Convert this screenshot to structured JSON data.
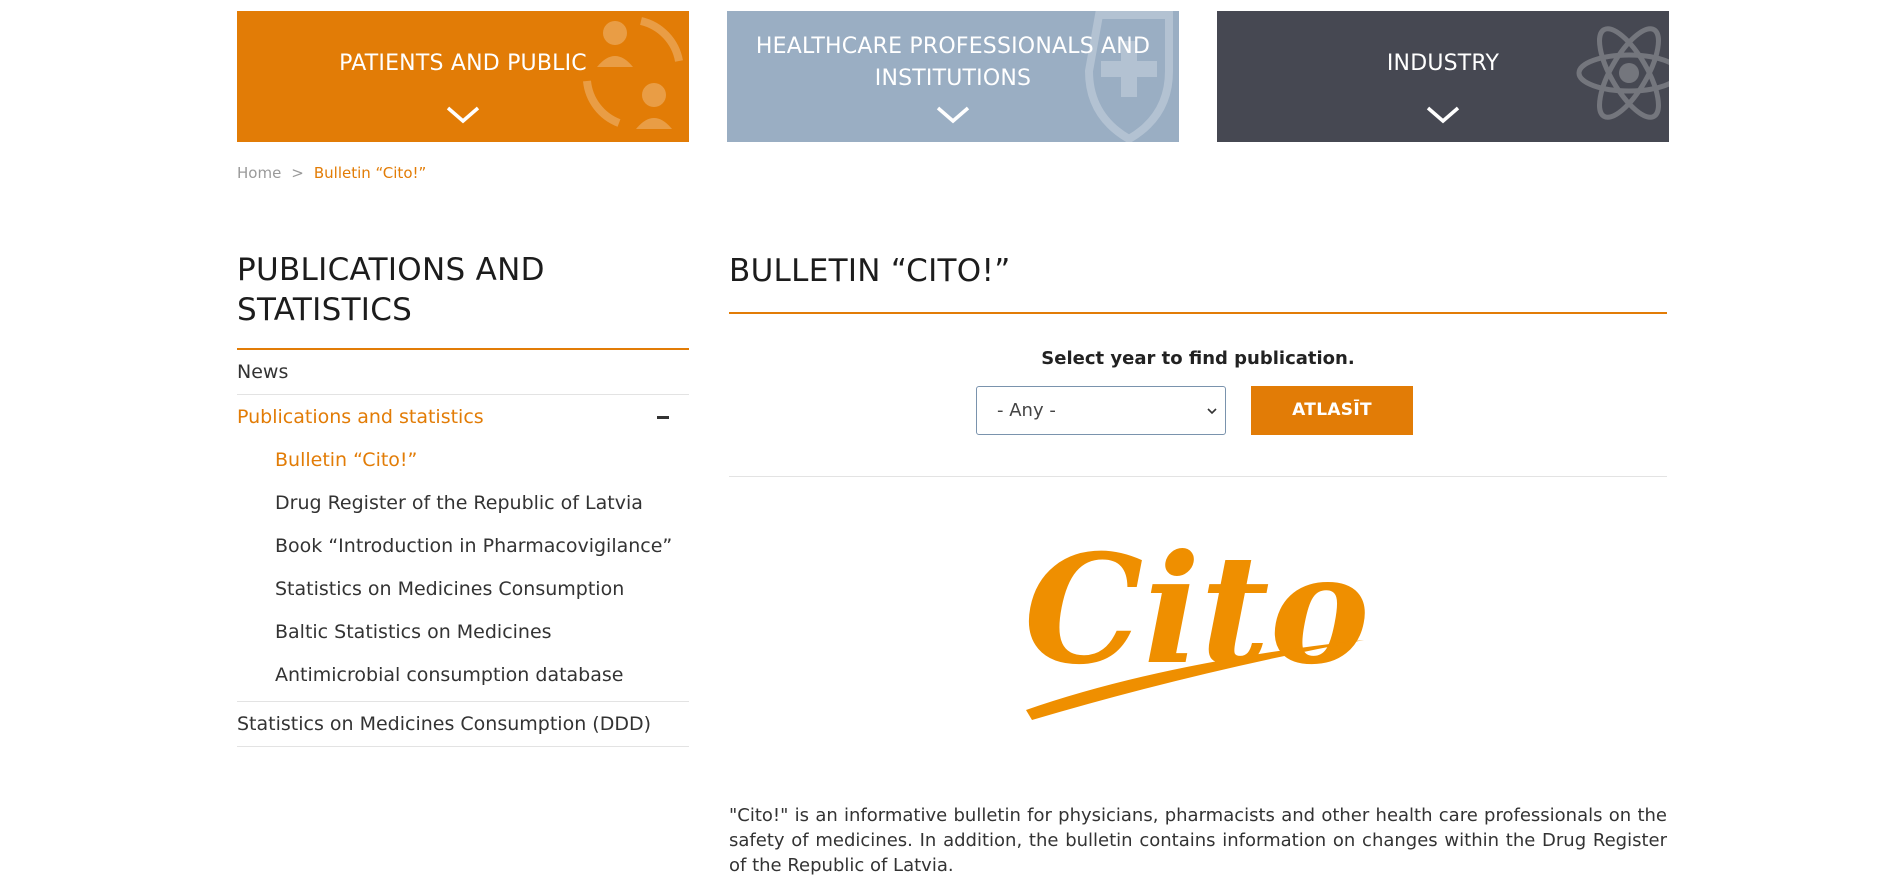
{
  "audience_tiles": {
    "patients": {
      "label": "PATIENTS AND PUBLIC",
      "color": "#e27c06"
    },
    "hcp": {
      "label_line1": "HEALTHCARE PROFESSIONALS AND",
      "label_line2": "INSTITUTIONS",
      "color": "#9aaec3"
    },
    "industry": {
      "label": "INDUSTRY",
      "color": "#464852"
    }
  },
  "breadcrumb": {
    "home": "Home",
    "separator": ">",
    "current": "Bulletin “Cito!”"
  },
  "sidebar": {
    "title": "PUBLICATIONS AND STATISTICS",
    "items": [
      {
        "label": "News"
      },
      {
        "label": "Publications and statistics",
        "expanded": true
      }
    ],
    "subitems": [
      {
        "label": "Bulletin “Cito!”",
        "current": true
      },
      {
        "label": "Drug Register of the Republic of Latvia"
      },
      {
        "label": "Book “Introduction in Pharmacovigilance”"
      },
      {
        "label": "Statistics on Medicines Consumption"
      },
      {
        "label": "Baltic Statistics on Medicines"
      },
      {
        "label": "Antimicrobial consumption database"
      }
    ],
    "last_item": {
      "label": "Statistics on Medicines Consumption (DDD)"
    }
  },
  "main": {
    "title": "BULLETIN “CITO!”",
    "filter": {
      "label": "Select year to find publication.",
      "year_select_value": "- Any -",
      "submit_label": "ATLASĪT"
    },
    "logo_text": "Cito!",
    "description": "\"Cito!\" is an informative bulletin for physicians, pharmacists and other health care professionals on the safety of medicines. In addition, the bulletin contains information on changes within the Drug Register of the Republic of Latvia."
  },
  "colors": {
    "accent": "#e27c06",
    "logo": "#ef8f00"
  }
}
